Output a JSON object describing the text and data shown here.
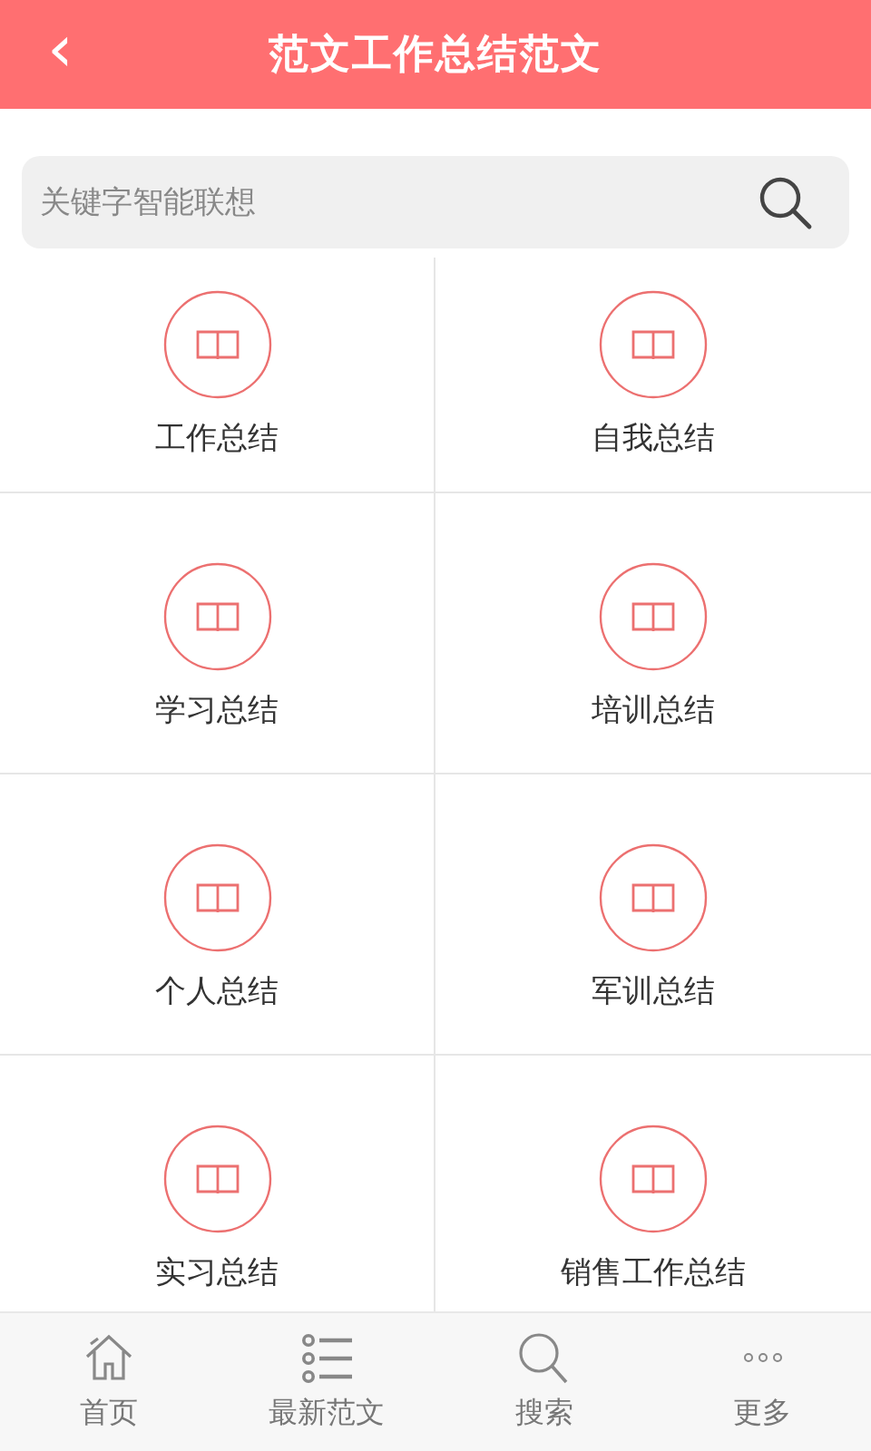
{
  "header": {
    "back": "‹",
    "title": "范文工作总结范文"
  },
  "search": {
    "placeholder": "关键字智能联想"
  },
  "categories": [
    {
      "label": "工作总结"
    },
    {
      "label": "自我总结"
    },
    {
      "label": "学习总结"
    },
    {
      "label": "培训总结"
    },
    {
      "label": "个人总结"
    },
    {
      "label": "军训总结"
    },
    {
      "label": "实习总结"
    },
    {
      "label": "销售工作总结"
    }
  ],
  "tab_bar": [
    {
      "kind": "home",
      "label": "首页"
    },
    {
      "kind": "list",
      "label": "最新范文"
    },
    {
      "kind": "search",
      "label": "搜索"
    },
    {
      "kind": "more",
      "label": "更多"
    }
  ]
}
